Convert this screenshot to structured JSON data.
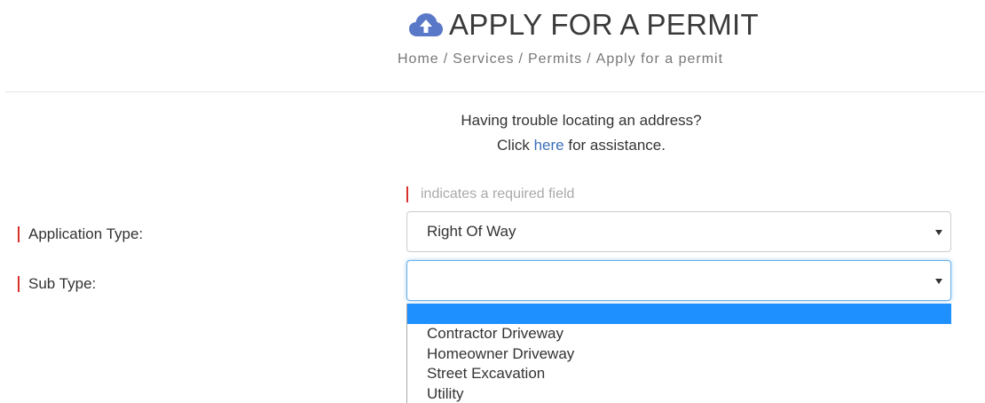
{
  "header": {
    "title": "APPLY FOR A PERMIT",
    "title_icon": "cloud-upload-icon",
    "title_icon_color": "#5a78c8",
    "breadcrumb": [
      "Home",
      "Services",
      "Permits",
      "Apply for a permit"
    ],
    "breadcrumb_separator": "/"
  },
  "help": {
    "line1": "Having trouble locating an address?",
    "line2_prefix": "Click",
    "line2_link": "here",
    "line2_suffix": "for assistance."
  },
  "form": {
    "required_note": "indicates a required field",
    "required_marker_color": "#d9302c",
    "fields": [
      {
        "label": "Application Type:",
        "selected_value": "Right Of Way"
      },
      {
        "label": "Sub Type:",
        "selected_value": "",
        "focused": true,
        "dropdown_open": true,
        "options": [
          "",
          "Contractor Driveway",
          "Homeowner Driveway",
          "Street Excavation",
          "Utility"
        ]
      }
    ]
  },
  "colors": {
    "link": "#3a6fb8",
    "focus_border": "#66afe9",
    "option_highlight": "#1e90ff"
  }
}
